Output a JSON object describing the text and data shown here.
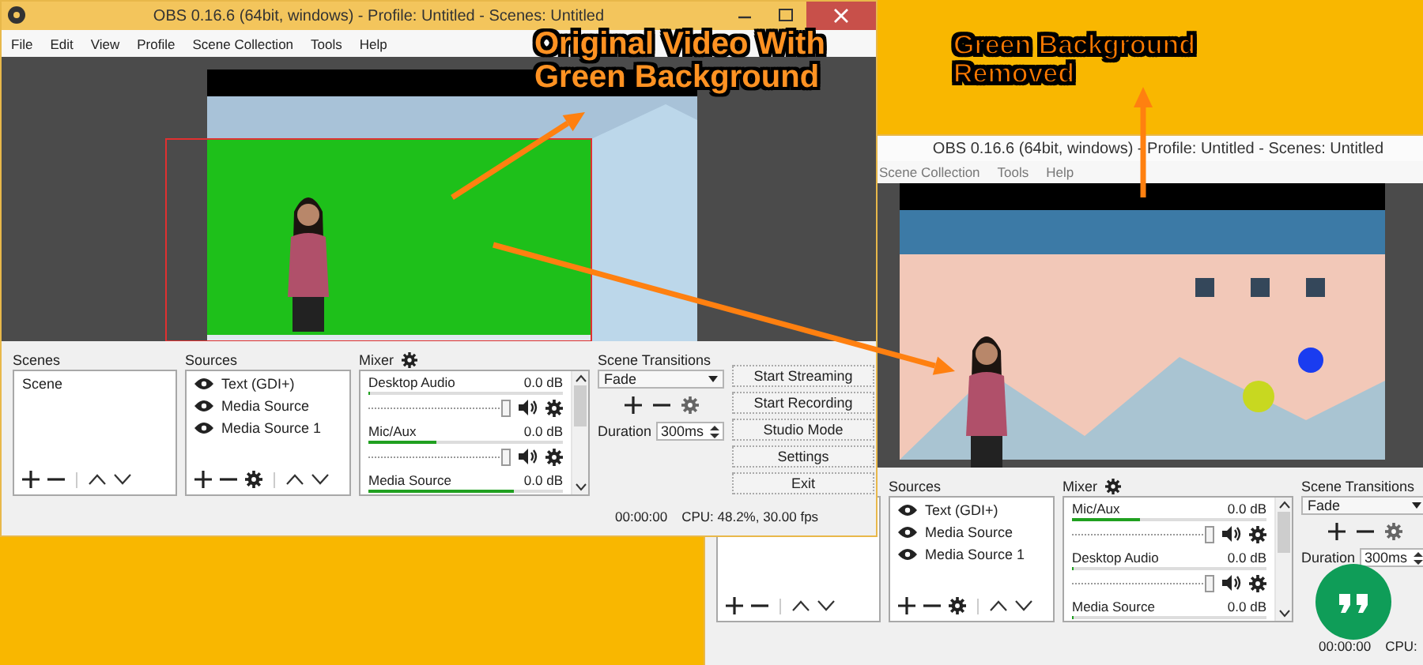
{
  "annotations": [
    {
      "text": "Original Video With Green Background"
    },
    {
      "text": "Green Background Removed"
    }
  ],
  "windows": [
    {
      "active": true,
      "title": "OBS 0.16.6 (64bit, windows) - Profile: Untitled - Scenes: Untitled",
      "menu": [
        "File",
        "Edit",
        "View",
        "Profile",
        "Scene Collection",
        "Tools",
        "Help"
      ],
      "scenes": {
        "title": "Scenes",
        "items": [
          {
            "label": "Scene",
            "selected": false
          }
        ]
      },
      "sources": {
        "title": "Sources",
        "items": [
          {
            "label": "Text (GDI+)",
            "visible": true
          },
          {
            "label": "Media Source",
            "visible": true
          },
          {
            "label": "Media Source 1",
            "visible": true
          }
        ]
      },
      "mixer": {
        "title": "Mixer",
        "channels": [
          {
            "name": "Desktop Audio",
            "reading": "0.0 dB",
            "meter": {
              "level": 0
            },
            "volume": {
              "level": 1
            }
          },
          {
            "name": "Mic/Aux",
            "reading": "0.0 dB",
            "meter": {
              "level": 0.35
            },
            "volume": {
              "level": 1
            }
          },
          {
            "name": "Media Source",
            "reading": "0.0 dB",
            "meter": {
              "level": 0.75
            }
          }
        ]
      },
      "transitions": {
        "title": "Scene Transitions",
        "select": "Fade",
        "duration_label": "Duration",
        "duration": "300ms"
      },
      "buttons": [
        "Start Streaming",
        "Start Recording",
        "Studio Mode",
        "Settings",
        "Exit"
      ],
      "status": {
        "time": "00:00:00",
        "cpu": "CPU: 48.2%, 30.00 fps"
      }
    },
    {
      "active": false,
      "title": "OBS 0.16.6 (64bit, windows) - Profile: Untitled - Scenes: Untitled",
      "menu": [
        "Scene Collection",
        "Tools",
        "Help"
      ],
      "sources": {
        "title": "Sources",
        "items": [
          {
            "label": "Text (GDI+)",
            "visible": true
          },
          {
            "label": "Media Source",
            "visible": true
          },
          {
            "label": "Media Source 1",
            "visible": true
          }
        ]
      },
      "mixer": {
        "title": "Mixer",
        "channels": [
          {
            "name": "Mic/Aux",
            "reading": "0.0 dB",
            "meter": {
              "level": 0.35
            },
            "volume": {
              "level": 1
            }
          },
          {
            "name": "Desktop Audio",
            "reading": "0.0 dB",
            "meter": {
              "level": 0
            },
            "volume": {
              "level": 1
            }
          },
          {
            "name": "Media Source",
            "reading": "0.0 dB",
            "meter": {
              "level": 0
            }
          }
        ]
      },
      "transitions": {
        "title": "Scene Transitions",
        "select": "Fade",
        "duration_label": "Duration",
        "duration": "300ms"
      },
      "status": {
        "time": "00:00:00",
        "cpu": "CPU:"
      }
    }
  ]
}
